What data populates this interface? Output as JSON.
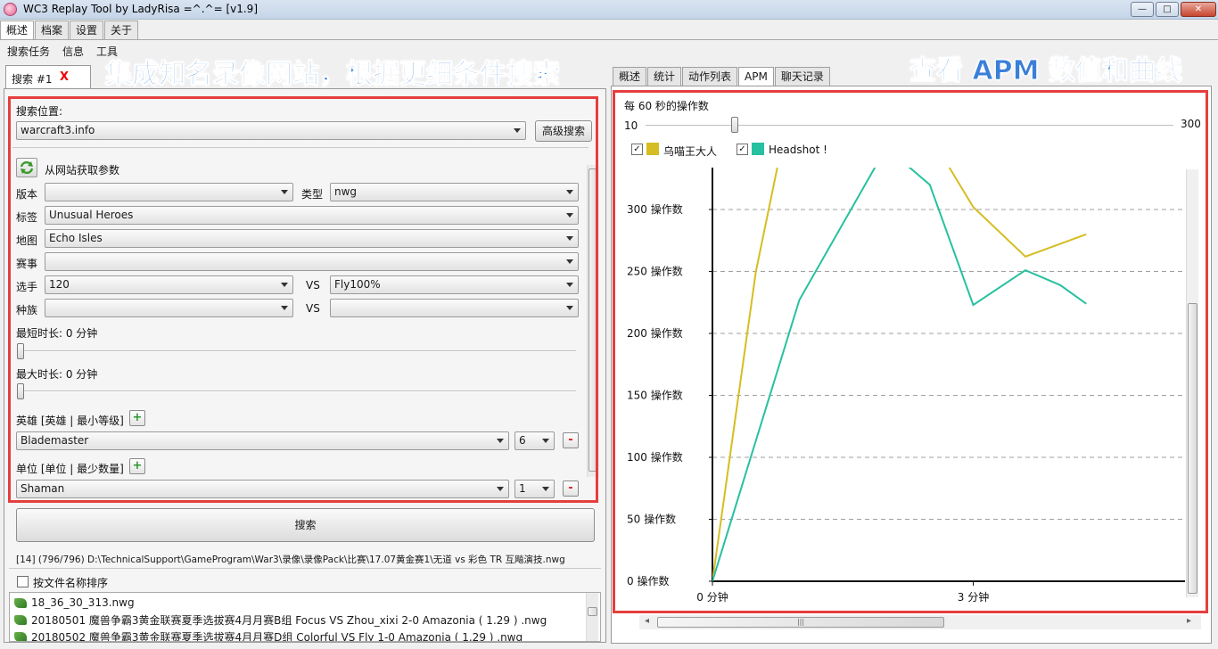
{
  "window": {
    "title": "WC3 Replay Tool by LadyRisa =^.^= [v1.9]",
    "minimize_label": "—",
    "maximize_label": "□",
    "close_label": "✕"
  },
  "top_tabs": [
    "概述",
    "档案",
    "设置",
    "关于"
  ],
  "menu": [
    "搜索任务",
    "信息",
    "工具"
  ],
  "banners": {
    "left": "集成知名录像网站，根据更细条件搜索",
    "right": "查看 APM 数值和曲线"
  },
  "search_tab": {
    "label": "搜索 #1",
    "close": "X"
  },
  "search_form": {
    "location_label": "搜索位置:",
    "location_value": "warcraft3.info",
    "advanced_button": "高级搜索",
    "fetch_params_label": "从网站获取参数",
    "version_label": "版本",
    "version_value": "",
    "type_label": "类型",
    "type_value": "nwg",
    "tag_label": "标签",
    "tag_value": "Unusual Heroes",
    "map_label": "地图",
    "map_value": "Echo Isles",
    "event_label": "赛事",
    "event_value": "",
    "player_label": "选手",
    "player1_value": "120",
    "vs_label": "VS",
    "player2_value": "Fly100%",
    "race_label": "种族",
    "race1_value": "",
    "race2_value": "",
    "min_duration_label": "最短时长: 0 分钟",
    "max_duration_label": "最大时长: 0 分钟",
    "hero_label": "英雄 [英雄 | 最小等级]",
    "hero_value": "Blademaster",
    "hero_level": "6",
    "unit_label": "单位 [单位 | 最少数量]",
    "unit_value": "Shaman",
    "unit_count": "1",
    "plus": "+",
    "minus": "-"
  },
  "search_button": "搜索",
  "status_line": "[14] (796/796) D:\\TechnicalSupport\\GameProgram\\War3\\录像\\录像Pack\\比赛\\17.07黄金赛1\\无道 vs 彩色 TR 互飚演技.nwg",
  "sort_by_filename": {
    "label": "按文件名称排序",
    "checked": false
  },
  "files": [
    "18_36_30_313.nwg",
    "20180501 魔兽争霸3黄金联赛夏季选拔赛4月月赛B组 Focus VS Zhou_xixi 2-0 Amazonia ( 1.29 ) .nwg",
    "20180502 魔兽争霸3黄金联赛夏季选拔赛4月月赛D组 Colorful VS Fly 1-0 Amazonia ( 1.29 ) .nwg"
  ],
  "right_tabs": [
    "概述",
    "统计",
    "动作列表",
    "APM",
    "聊天记录"
  ],
  "right_active_tab": "APM",
  "apm": {
    "window_label": "每 60 秒的操作数",
    "slider_min": "10",
    "slider_max": "300",
    "slider_value": 10,
    "scroll_left": "◂",
    "scroll_right": "▸",
    "scroll_grip": "|||"
  },
  "chart_data": {
    "type": "line",
    "title": "",
    "xlabel": "",
    "ylabel": "",
    "x_ticks": [
      "0 分钟",
      "3 分钟"
    ],
    "y_ticks": [
      "0 操作数",
      "50 操作数",
      "100 操作数",
      "150 操作数",
      "200 操作数",
      "250 操作数",
      "300 操作数"
    ],
    "ylim": [
      0,
      330
    ],
    "xlim": [
      0,
      4.3
    ],
    "grid": true,
    "legend_position": "top-left",
    "series": [
      {
        "name": "乌喵王大人",
        "color": "#d6bd23",
        "checked": true,
        "x": [
          0,
          0.5,
          1.0,
          2.0,
          2.5,
          3.0,
          3.6,
          4.3
        ],
        "y": [
          0,
          250,
          420,
          520,
          360,
          302,
          262,
          280
        ]
      },
      {
        "name": "Headshot !",
        "color": "#27c0a0",
        "checked": true,
        "x": [
          0,
          1.0,
          2.0,
          2.5,
          3.0,
          3.6,
          4.0,
          4.3
        ],
        "y": [
          0,
          227,
          350,
          320,
          223,
          251,
          239,
          224
        ]
      }
    ]
  }
}
